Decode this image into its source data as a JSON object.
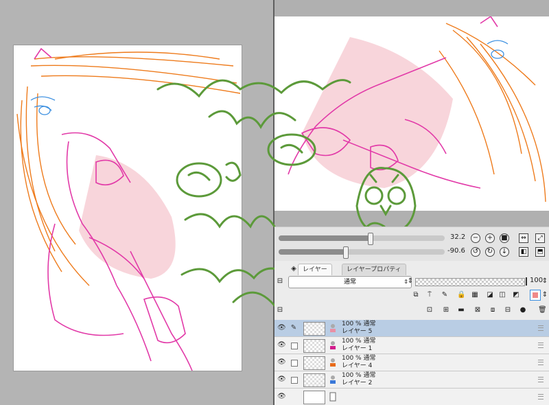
{
  "navigator": {
    "zoom_value": "32.2",
    "rotation_value": "-90.6",
    "zoom_fill_pct": 0.55,
    "rotation_fill_pct": 0.4
  },
  "layers_panel": {
    "tabs": [
      {
        "label": "レイヤー"
      },
      {
        "label": "レイヤープロパティ"
      }
    ],
    "blend_mode": "通常",
    "opacity": "100",
    "layers": [
      {
        "meta": "100 % 通常",
        "name": "レイヤー 5",
        "selected": true,
        "color": "#e98fa4"
      },
      {
        "meta": "100 % 通常",
        "name": "レイヤー 1",
        "selected": false,
        "color": "#d31c8c"
      },
      {
        "meta": "100 % 通常",
        "name": "レイヤー 4",
        "selected": false,
        "color": "#e86c1a"
      },
      {
        "meta": "100 % 通常",
        "name": "レイヤー 2",
        "selected": false,
        "color": "#3a78d8"
      },
      {
        "meta": "",
        "name": "",
        "selected": false,
        "color": "#cccccc"
      }
    ]
  },
  "colors": {
    "sketch_pink": "#e23aa8",
    "sketch_orange": "#ee7b1c",
    "sketch_blue": "#3b8fe0",
    "fill_pink": "#f6c7cf",
    "handwriting_green": "#5c9a3a"
  }
}
